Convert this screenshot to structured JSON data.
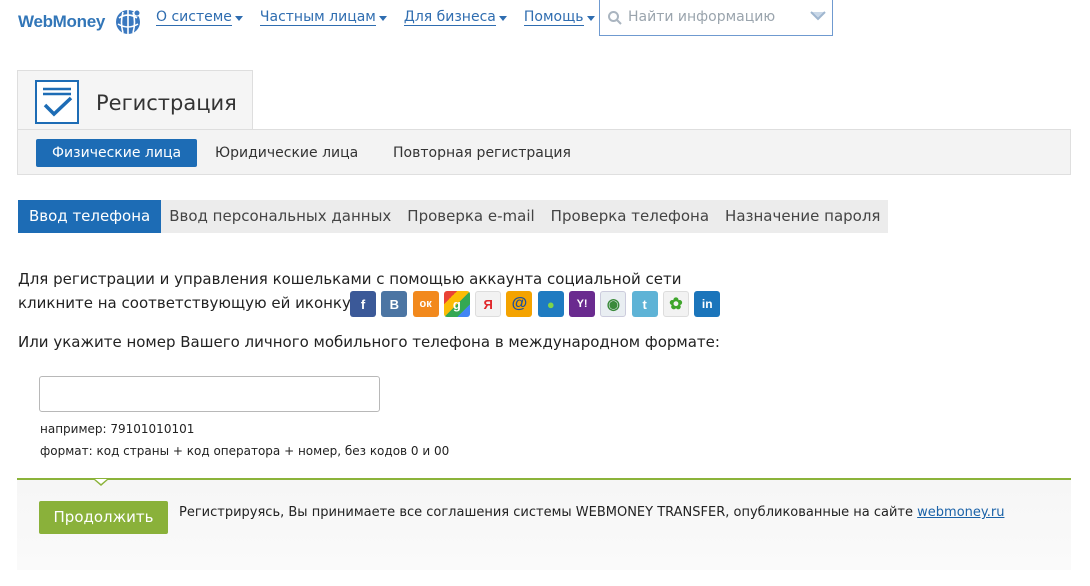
{
  "header": {
    "logo_text": "WebMoney",
    "nav": [
      {
        "label": "О системе"
      },
      {
        "label": "Частным лицам"
      },
      {
        "label": "Для бизнеса"
      },
      {
        "label": "Помощь"
      }
    ],
    "search_placeholder": "Найти информацию"
  },
  "registration": {
    "title": "Регистрация",
    "subtabs": [
      "Физические лица",
      "Юридические лица",
      "Повторная регистрация"
    ],
    "active_subtab": 0
  },
  "steps": [
    "Ввод телефона",
    "Ввод персональных данных",
    "Проверка e-mail",
    "Проверка телефона",
    "Назначение пароля"
  ],
  "social": {
    "line1": "Для регистрации и управления кошельками с помощью аккаунта социальной сети",
    "line2": "кликните на соответствующую ей иконку:",
    "icons": [
      {
        "name": "facebook-icon",
        "color": "#3b5998",
        "glyph": "f"
      },
      {
        "name": "vkontakte-icon",
        "color": "#4c75a3",
        "glyph": "B"
      },
      {
        "name": "odnoklassniki-icon",
        "color": "#f2891d",
        "glyph": "ок"
      },
      {
        "name": "google-icon",
        "color": "#3aa757",
        "glyph": "g"
      },
      {
        "name": "yandex-icon",
        "color": "#f2f2f2",
        "glyph": "Я"
      },
      {
        "name": "mailru-icon",
        "color": "#f4a300",
        "glyph": "@"
      },
      {
        "name": "myworld-icon",
        "color": "#1f7bc1",
        "glyph": "●"
      },
      {
        "name": "yahoo-icon",
        "color": "#6a2b8f",
        "glyph": "Y!"
      },
      {
        "name": "openid-icon",
        "color": "#e9eef2",
        "glyph": "◉"
      },
      {
        "name": "twitter-icon",
        "color": "#5eb3d6",
        "glyph": "t"
      },
      {
        "name": "icq-icon",
        "color": "#f2f2f2",
        "glyph": "✿"
      },
      {
        "name": "linkedin-icon",
        "color": "#1b75bb",
        "glyph": "in"
      }
    ]
  },
  "phone": {
    "prompt": "Или укажите номер Вашего личного мобильного телефона в международном формате:",
    "value": "",
    "example": "например: 79101010101",
    "format": "формат: код страны + код оператора + номер, без кодов 0 и 00"
  },
  "footer": {
    "button": "Продолжить",
    "agreement": "Регистрируясь, Вы принимаете все соглашения системы WEBMONEY TRANSFER, опубликованные на сайте",
    "link": "webmoney.ru"
  },
  "colors": {
    "accent": "#1d6cb5",
    "green": "#8ab13a"
  }
}
